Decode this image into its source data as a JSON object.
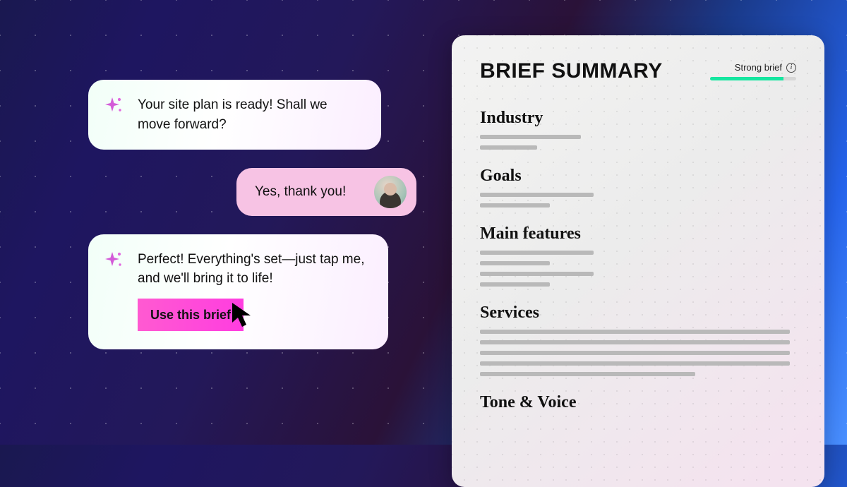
{
  "chat": {
    "ai1": "Your site plan is ready! Shall we move forward?",
    "user1": "Yes, thank you!",
    "ai2": "Perfect! Everything's set—just tap me, and we'll bring it to life!",
    "cta_label": "Use this brief"
  },
  "panel": {
    "title": "BRIEF SUMMARY",
    "strength_label": "Strong brief",
    "strength_pct": "85",
    "sections": {
      "industry": "Industry",
      "goals": "Goals",
      "features": "Main features",
      "services": "Services",
      "tone": "Tone & Voice"
    }
  }
}
